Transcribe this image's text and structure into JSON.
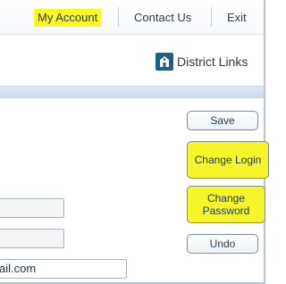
{
  "topnav": {
    "my_account": "My Account",
    "contact_us": "Contact Us",
    "exit": "Exit"
  },
  "district_links": {
    "label": "District Links",
    "icon": "building-icon"
  },
  "buttons": {
    "save": "Save",
    "change_login": "Change Login",
    "change_password": "Change Password",
    "undo": "Undo"
  },
  "fields": {
    "email_value": "ail.com"
  },
  "colors": {
    "highlight": "#f7f72b",
    "accent": "#1f5f86"
  }
}
